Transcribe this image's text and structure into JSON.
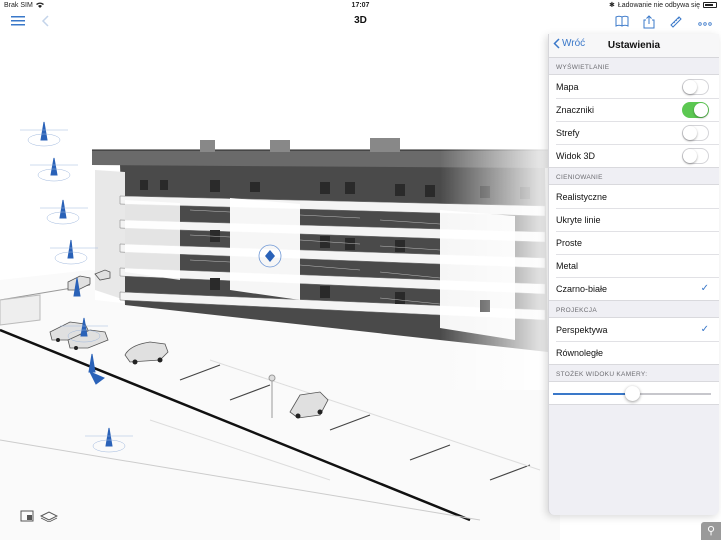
{
  "status_bar": {
    "carrier": "Brak SIM",
    "time": "17:07",
    "charging_text": "Ładowanie nie odbywa się"
  },
  "nav": {
    "title": "3D",
    "icons": [
      "list-icon",
      "back-arrow-icon",
      "book-icon",
      "share-icon",
      "ruler-icon",
      "more-icon"
    ]
  },
  "settings": {
    "back_label": "Wróć",
    "title": "Ustawienia",
    "display": {
      "label": "WYŚWIETLANIE",
      "items": [
        {
          "label": "Mapa",
          "on": false
        },
        {
          "label": "Znaczniki",
          "on": true
        },
        {
          "label": "Strefy",
          "on": false
        },
        {
          "label": "Widok 3D",
          "on": false
        }
      ]
    },
    "shading": {
      "label": "CIENIOWANIE",
      "items": [
        {
          "label": "Realistyczne",
          "selected": false
        },
        {
          "label": "Ukryte linie",
          "selected": false
        },
        {
          "label": "Proste",
          "selected": false
        },
        {
          "label": "Metal",
          "selected": false
        },
        {
          "label": "Czarno-białe",
          "selected": true
        }
      ]
    },
    "projection": {
      "label": "PROJEKCJA",
      "items": [
        {
          "label": "Perspektywa",
          "selected": true
        },
        {
          "label": "Równoległe",
          "selected": false
        }
      ]
    },
    "camera_cone": {
      "label": "STOŻEK WIDOKU KAMERY:",
      "value": 0.5
    }
  },
  "colors": {
    "accent": "#3a78c9",
    "toggle_on": "#5cc852"
  }
}
